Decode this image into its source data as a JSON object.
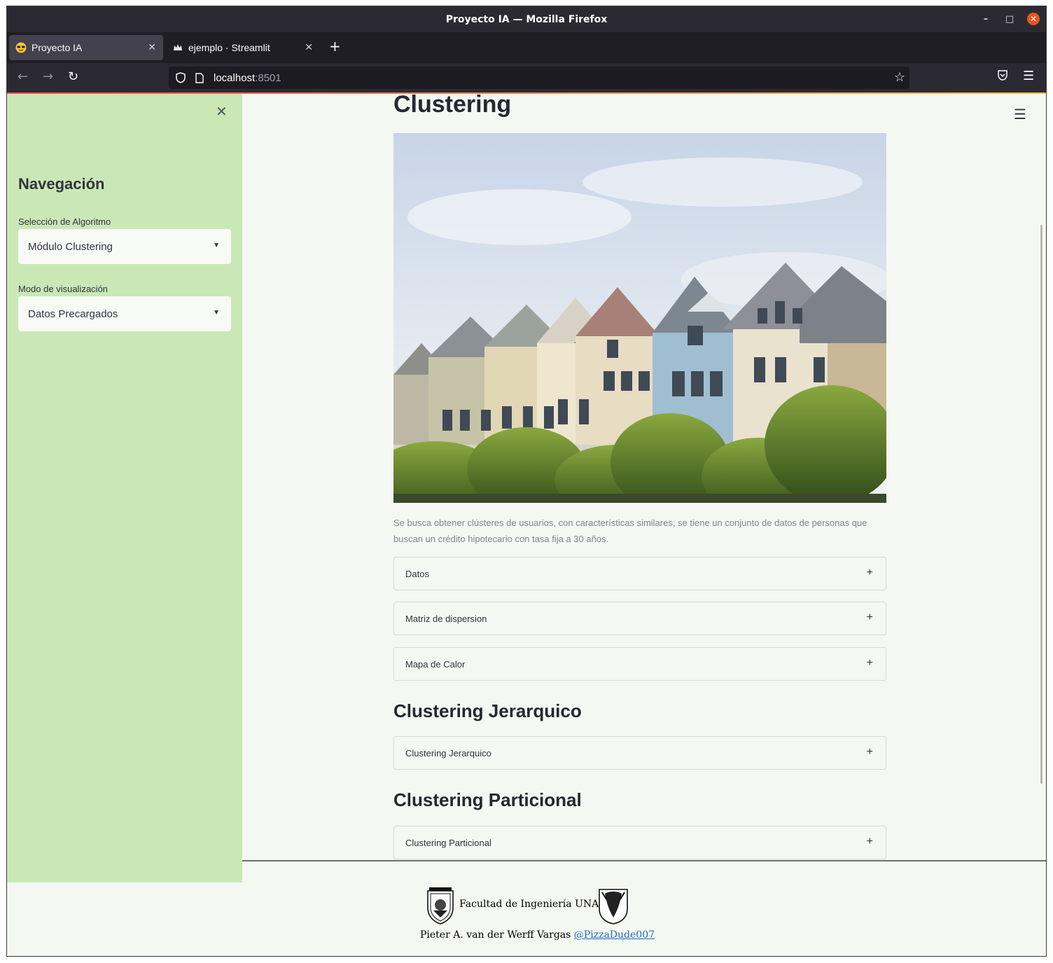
{
  "window": {
    "title": "Proyecto IA — Mozilla Firefox"
  },
  "tabs": [
    {
      "label": "Proyecto IA",
      "icon": "sunglasses-emoji-icon",
      "active": true
    },
    {
      "label": "ejemplo · Streamlit",
      "icon": "crown-icon",
      "active": false
    }
  ],
  "urlbar": {
    "host": "localhost",
    "port": ":8501"
  },
  "sidebar": {
    "title": "Navegación",
    "algo_label": "Selección de Algoritmo",
    "algo_value": "Módulo Clustering",
    "mode_label": "Modo de visualización",
    "mode_value": "Datos Precargados"
  },
  "main": {
    "title": "Clustering",
    "description": "Se busca obtener clústeres de usuarios, con características similares, se tiene un conjunto de datos de personas que buscan un crédito hipotecario con tasa fija a 30 años.",
    "expanders": [
      "Datos",
      "Matriz de dispersion",
      "Mapa de Calor"
    ],
    "section_jerarquico": {
      "title": "Clustering Jerarquico",
      "expander": "Clustering Jerarquico"
    },
    "section_particional": {
      "title": "Clustering Particional",
      "expander": "Clustering Particional"
    }
  },
  "footer": {
    "institution": "Facultad de Ingeniería UNAM",
    "author": "Pieter A. van der Werff Vargas",
    "handle": "@PizzaDude007"
  },
  "colors": {
    "sidebar_bg": "#c9e8b6",
    "main_bg": "#f5f7f2",
    "accent": "#ff4b4b",
    "link": "#1a6ec7"
  }
}
